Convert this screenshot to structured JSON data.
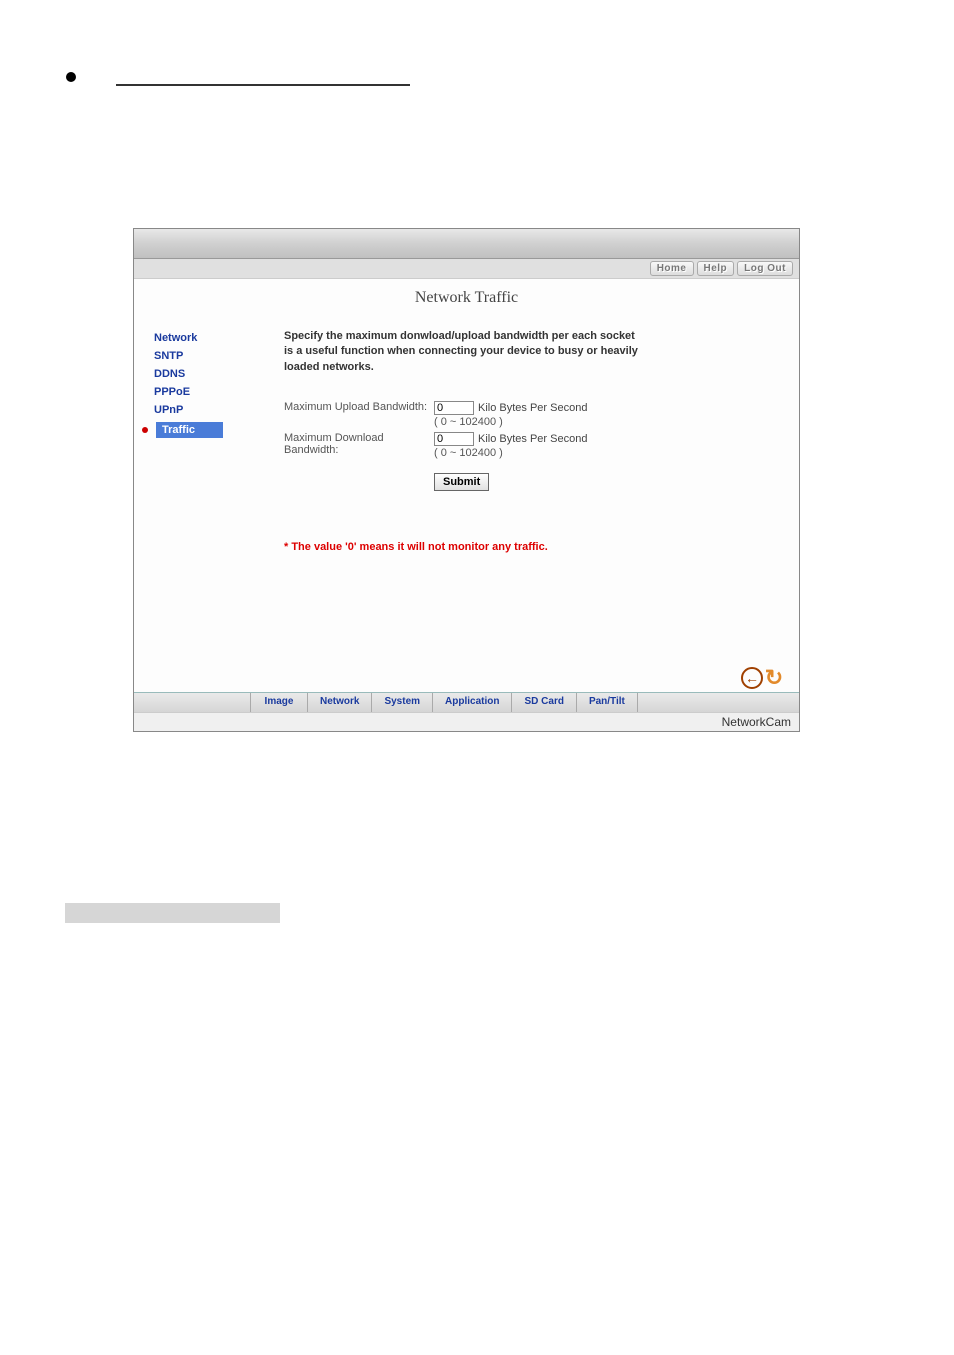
{
  "topbar": {
    "home": "Home",
    "help": "Help",
    "logout": "Log Out"
  },
  "page_title": "Network Traffic",
  "sidebar": {
    "items": [
      {
        "label": "Network"
      },
      {
        "label": "SNTP"
      },
      {
        "label": "DDNS"
      },
      {
        "label": "PPPoE"
      },
      {
        "label": "UPnP"
      },
      {
        "label": "Traffic"
      }
    ]
  },
  "intro_text": "Specify the maximum donwload/upload bandwidth per each socket is a useful function when connecting your device to busy or heavily loaded networks.",
  "form": {
    "upload_label": "Maximum Upload Bandwidth:",
    "download_label": "Maximum Download Bandwidth:",
    "upload_value": "0",
    "download_value": "0",
    "unit": "Kilo Bytes Per Second",
    "range": "( 0 ~ 102400 )",
    "submit": "Submit"
  },
  "footnote": "* The value '0' means it will not monitor any traffic.",
  "bottom_tabs": [
    "Image",
    "Network",
    "System",
    "Application",
    "SD Card",
    "Pan/Tilt"
  ],
  "brand": "NetworkCam"
}
